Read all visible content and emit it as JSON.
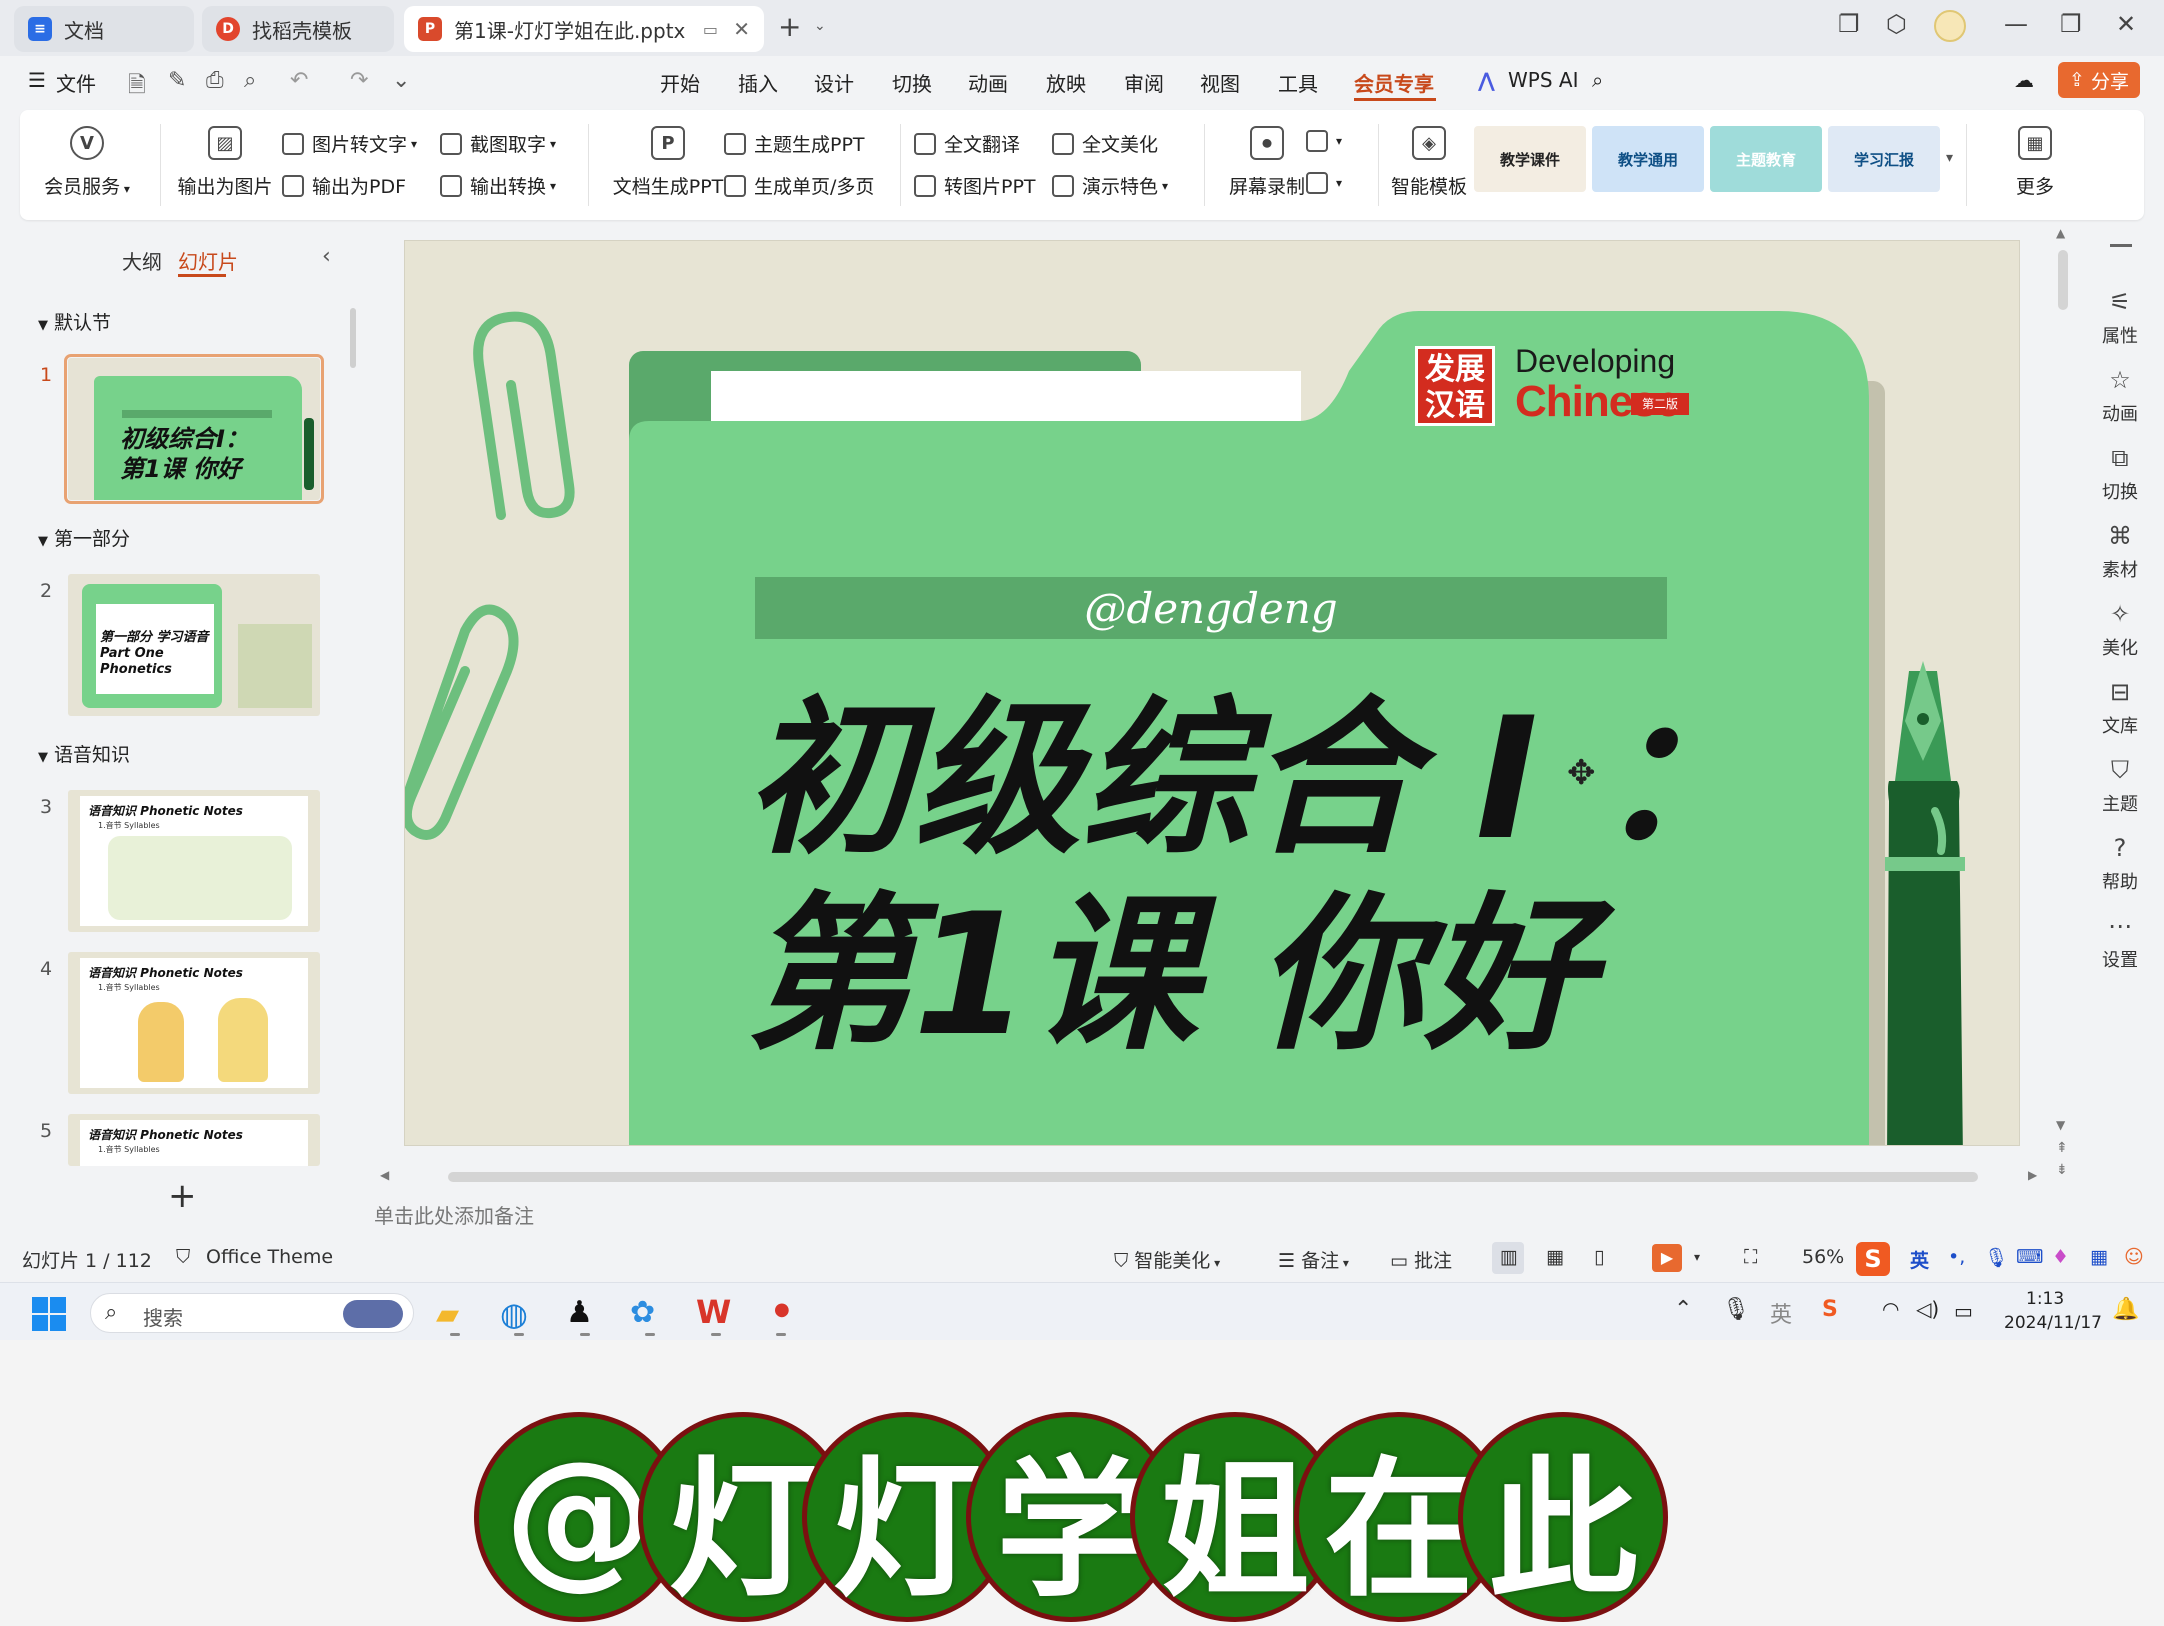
{
  "tabs": [
    {
      "label": "文档",
      "icon": "docs-icon"
    },
    {
      "label": "找稻壳模板",
      "icon": "docer-icon"
    },
    {
      "label": "第1课-灯灯学姐在此.pptx",
      "icon": "ppt-file-icon"
    }
  ],
  "menu": {
    "file": "文件",
    "items": [
      "开始",
      "插入",
      "设计",
      "切换",
      "动画",
      "放映",
      "审阅",
      "视图",
      "工具",
      "会员专享"
    ],
    "active": "会员专享",
    "wps_ai": "WPS AI",
    "share": "分享"
  },
  "ribbon": {
    "member_service": "会员服务",
    "export_image": "输出为图片",
    "image_to_text": "图片转文字",
    "export_pdf": "输出为PDF",
    "screenshot_text": "截图取字",
    "export_convert": "输出转换",
    "doc_to_ppt": "文档生成PPT",
    "topic_ppt": "主题生成PPT",
    "single_multi": "生成单页/多页",
    "translate": "全文翻译",
    "image_ppt": "转图片PPT",
    "beautify": "全文美化",
    "present_special": "演示特色",
    "screen_record": "屏幕录制",
    "smart_template": "智能模板",
    "more": "更多",
    "templates": [
      "教学课件",
      "教学通用",
      "主题教育",
      "学习汇报"
    ]
  },
  "left_panel": {
    "tab_outline": "大纲",
    "tab_slides": "幻灯片",
    "sections": [
      "默认节",
      "第一部分",
      "语音知识"
    ],
    "slides": [
      {
        "num": "1",
        "title_line1": "初级综合Ⅰ：",
        "title_line2": "第1课 你好"
      },
      {
        "num": "2",
        "title_line1": "第一部分 学习语音",
        "title_line2": "Part One Phonetics"
      },
      {
        "num": "3",
        "title_line1": "语音知识 Phonetic Notes",
        "title_line2": "1.音节 Syllables"
      },
      {
        "num": "4",
        "title_line1": "语音知识 Phonetic Notes",
        "title_line2": "1.音节 Syllables"
      },
      {
        "num": "5",
        "title_line1": "语音知识 Phonetic Notes",
        "title_line2": "1.音节 Syllables"
      }
    ]
  },
  "slide": {
    "watermark": "@dengdeng",
    "title_line1": "初级综合 Ⅰ ：",
    "title_line2": "第1课 你好",
    "logo_cn_top": "发展",
    "logo_cn_bottom": "汉语",
    "logo_en_top": "Developing",
    "logo_en_bottom": "Chinese",
    "logo_edition": "第二版"
  },
  "notes_placeholder": "单击此处添加备注",
  "right_sidebar": [
    "属性",
    "动画",
    "切换",
    "素材",
    "美化",
    "文库",
    "主题",
    "帮助",
    "设置"
  ],
  "status": {
    "slide_count": "幻灯片 1 / 112",
    "theme": "Office Theme",
    "smart_beautify": "智能美化",
    "notes": "备注",
    "comments": "批注",
    "zoom": "56%",
    "ime": "英"
  },
  "taskbar": {
    "search": "搜索",
    "time": "1:13",
    "date": "2024/11/17",
    "ime_lang": "英"
  },
  "overlay_chars": [
    "@",
    "灯",
    "灯",
    "学",
    "姐",
    "在",
    "此"
  ],
  "colors": {
    "accent": "#c8491b",
    "folder_green": "#77d28b",
    "folder_dark": "#5aa96b",
    "slide_bg": "#e7e4d4",
    "overlay_circle": "#1a7a12"
  }
}
